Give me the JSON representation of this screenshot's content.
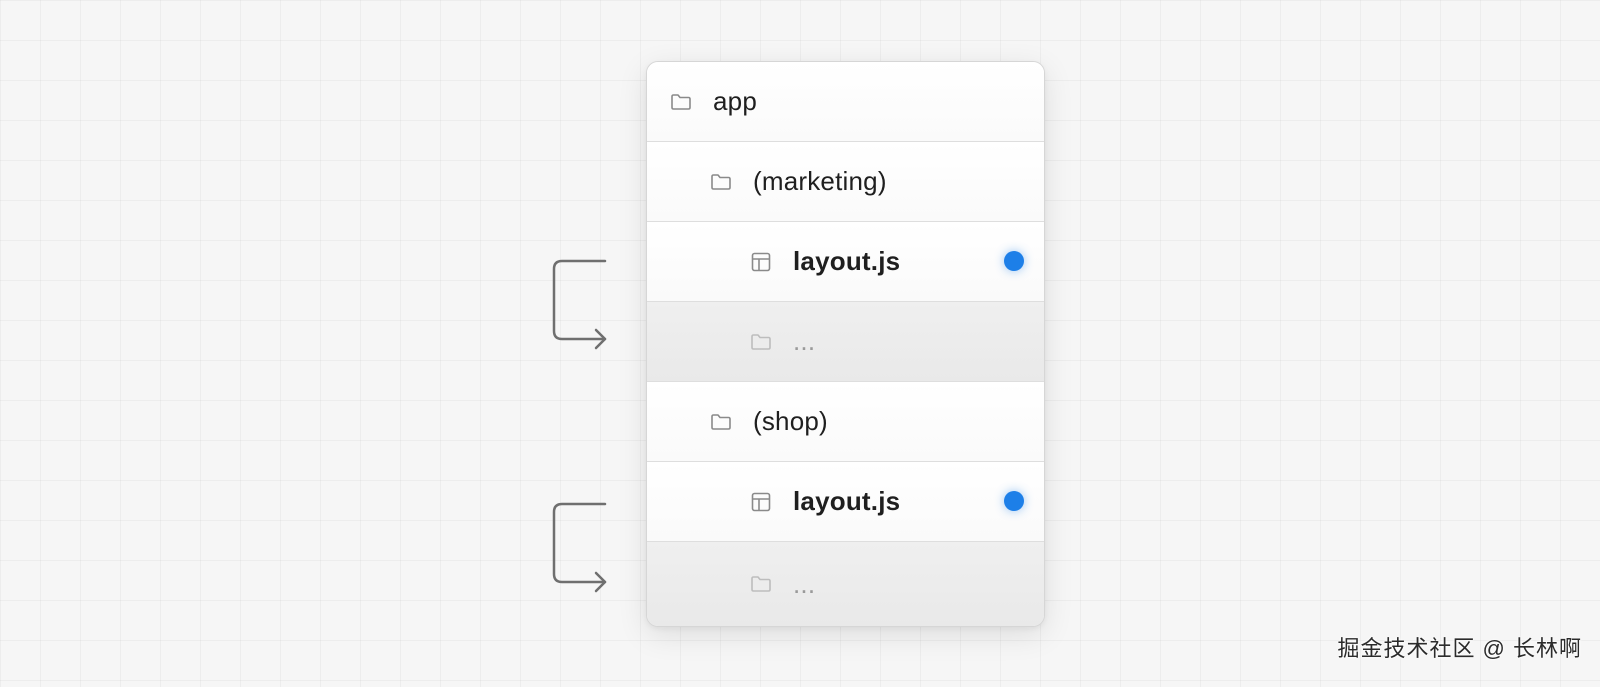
{
  "tree": {
    "rows": [
      {
        "label": "app",
        "icon": "folder-icon"
      },
      {
        "label": "(marketing)",
        "icon": "folder-icon"
      },
      {
        "label": "layout.js",
        "icon": "layout-file-icon",
        "marker_color": "#1d7fe8"
      },
      {
        "label": "...",
        "icon": "folder-icon"
      },
      {
        "label": "(shop)",
        "icon": "folder-icon"
      },
      {
        "label": "layout.js",
        "icon": "layout-file-icon",
        "marker_color": "#1d7fe8"
      },
      {
        "label": "...",
        "icon": "folder-icon"
      }
    ]
  },
  "watermark": "掘金技术社区 @ 长林啊"
}
